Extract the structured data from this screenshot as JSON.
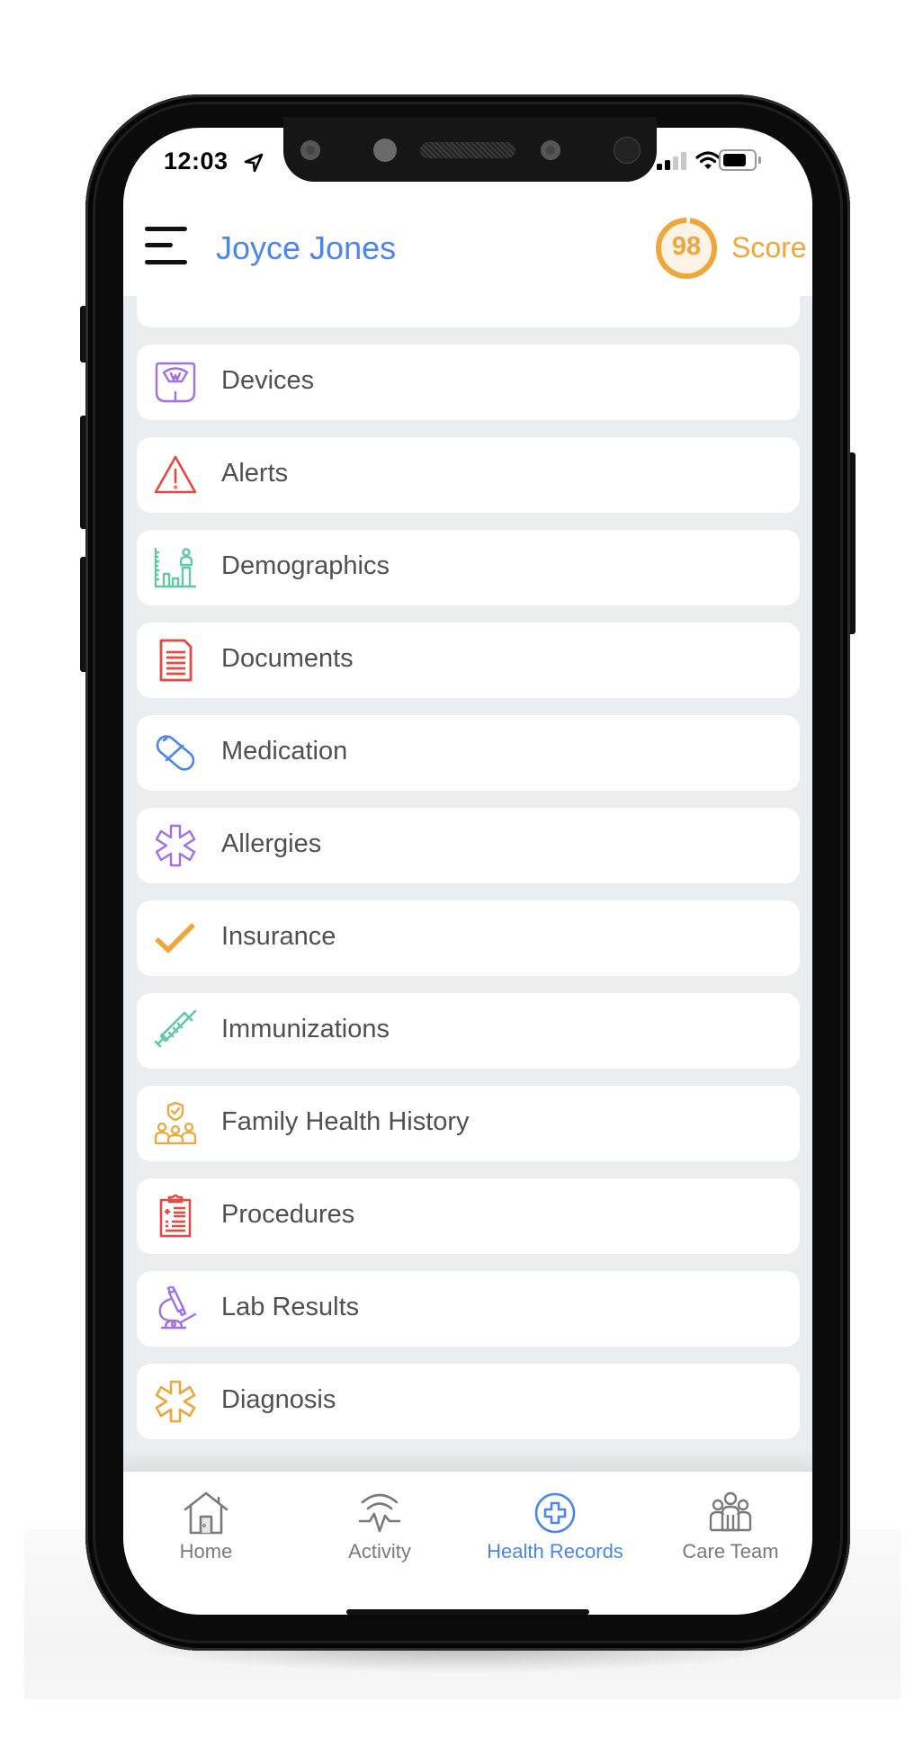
{
  "status_bar": {
    "time": "12:03",
    "location_icon": "location-arrow-icon",
    "signal_bars_filled": 2,
    "signal_bars_total": 4,
    "wifi_icon": "wifi-icon",
    "battery_icon": "battery-icon"
  },
  "header": {
    "menu_icon": "hamburger-menu-icon",
    "user_name": "Joyce Jones",
    "score_value": "98",
    "score_percent": 98,
    "score_label": "Score"
  },
  "colors": {
    "accent_blue": "#4a86ee",
    "score_orange": "#efa63a",
    "background_gray": "#eaeef1",
    "label_gray": "#505050",
    "purple": "#a070e8",
    "red": "#e8483f",
    "green": "#5fcaa4",
    "orange": "#efa63a"
  },
  "menu": {
    "items": [
      {
        "label": "Devices",
        "icon": "scale-icon",
        "color": "#a070e8"
      },
      {
        "label": "Alerts",
        "icon": "warning-triangle-icon",
        "color": "#e8483f"
      },
      {
        "label": "Demographics",
        "icon": "growth-chart-icon",
        "color": "#5fcaa4"
      },
      {
        "label": "Documents",
        "icon": "document-icon",
        "color": "#e8483f"
      },
      {
        "label": "Medication",
        "icon": "pill-capsule-icon",
        "color": "#4a86ee"
      },
      {
        "label": "Allergies",
        "icon": "asterisk-icon",
        "color": "#a070e8"
      },
      {
        "label": "Insurance",
        "icon": "checkmark-icon",
        "color": "#efa63a"
      },
      {
        "label": "Immunizations",
        "icon": "syringe-icon",
        "color": "#5fcaa4"
      },
      {
        "label": "Family Health History",
        "icon": "family-shield-icon",
        "color": "#efa63a"
      },
      {
        "label": "Procedures",
        "icon": "clipboard-icon",
        "color": "#e8483f"
      },
      {
        "label": "Lab Results",
        "icon": "microscope-icon",
        "color": "#a070e8"
      },
      {
        "label": "Diagnosis",
        "icon": "medical-star-icon",
        "color": "#efa63a"
      }
    ]
  },
  "bottom_nav": {
    "items": [
      {
        "label": "Home",
        "icon": "home-icon",
        "active": false
      },
      {
        "label": "Activity",
        "icon": "activity-pulse-icon",
        "active": false
      },
      {
        "label": "Health Records",
        "icon": "health-records-cross-icon",
        "active": true
      },
      {
        "label": "Care Team",
        "icon": "care-team-icon",
        "active": false
      }
    ]
  }
}
